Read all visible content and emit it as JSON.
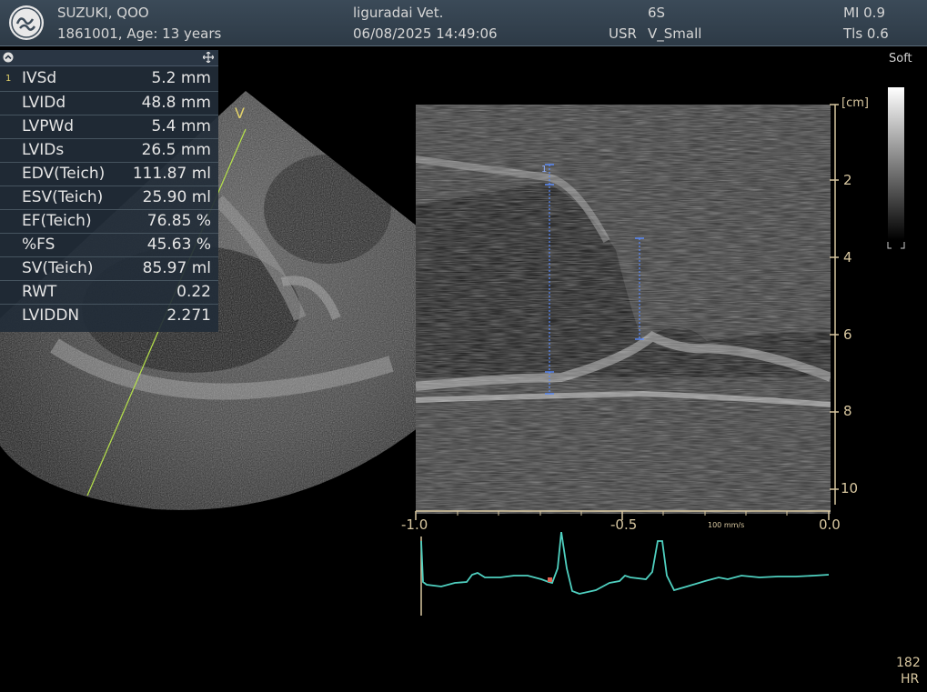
{
  "header": {
    "patient_name": "SUZUKI, QOO",
    "patient_info": "1861001, Age: 13 years",
    "clinic": "liguradai Vet.",
    "datetime": "06/08/2025 14:49:06",
    "probe": "6S",
    "preset_user": "USR",
    "preset_name": "V_Small",
    "mi": "MI 0.9",
    "tis": "Tls 0.6"
  },
  "measurements": [
    {
      "label": "IVSd",
      "value": "5.2 mm"
    },
    {
      "label": "LVIDd",
      "value": "48.8 mm"
    },
    {
      "label": "LVPWd",
      "value": "5.4 mm"
    },
    {
      "label": "LVIDs",
      "value": "26.5 mm"
    },
    {
      "label": "EDV(Teich)",
      "value": "111.87 ml"
    },
    {
      "label": "ESV(Teich)",
      "value": "25.90 ml"
    },
    {
      "label": "EF(Teich)",
      "value": "76.85 %"
    },
    {
      "label": "%FS",
      "value": "45.63 %"
    },
    {
      "label": "SV(Teich)",
      "value": "85.97 ml"
    },
    {
      "label": "RWT",
      "value": "0.22"
    },
    {
      "label": "LVIDDN",
      "value": "2.271"
    }
  ],
  "panel_index": "1",
  "bmode_marker": "V",
  "depth_unit": "[cm]",
  "depth_ticks": [
    "2",
    "4",
    "6",
    "8",
    "10"
  ],
  "time_ticks": [
    "-1.0",
    "-0.5",
    "0.0"
  ],
  "sweep_speed": "100 mm/s",
  "caliper_marker": "1",
  "map_label": "Soft",
  "heart_rate": "182",
  "heart_rate_label": "HR",
  "colors": {
    "accent": "#d8c7a0",
    "ecg": "#4fd0c0",
    "caliper": "#5a8cff",
    "marker": "#b7e34a"
  }
}
